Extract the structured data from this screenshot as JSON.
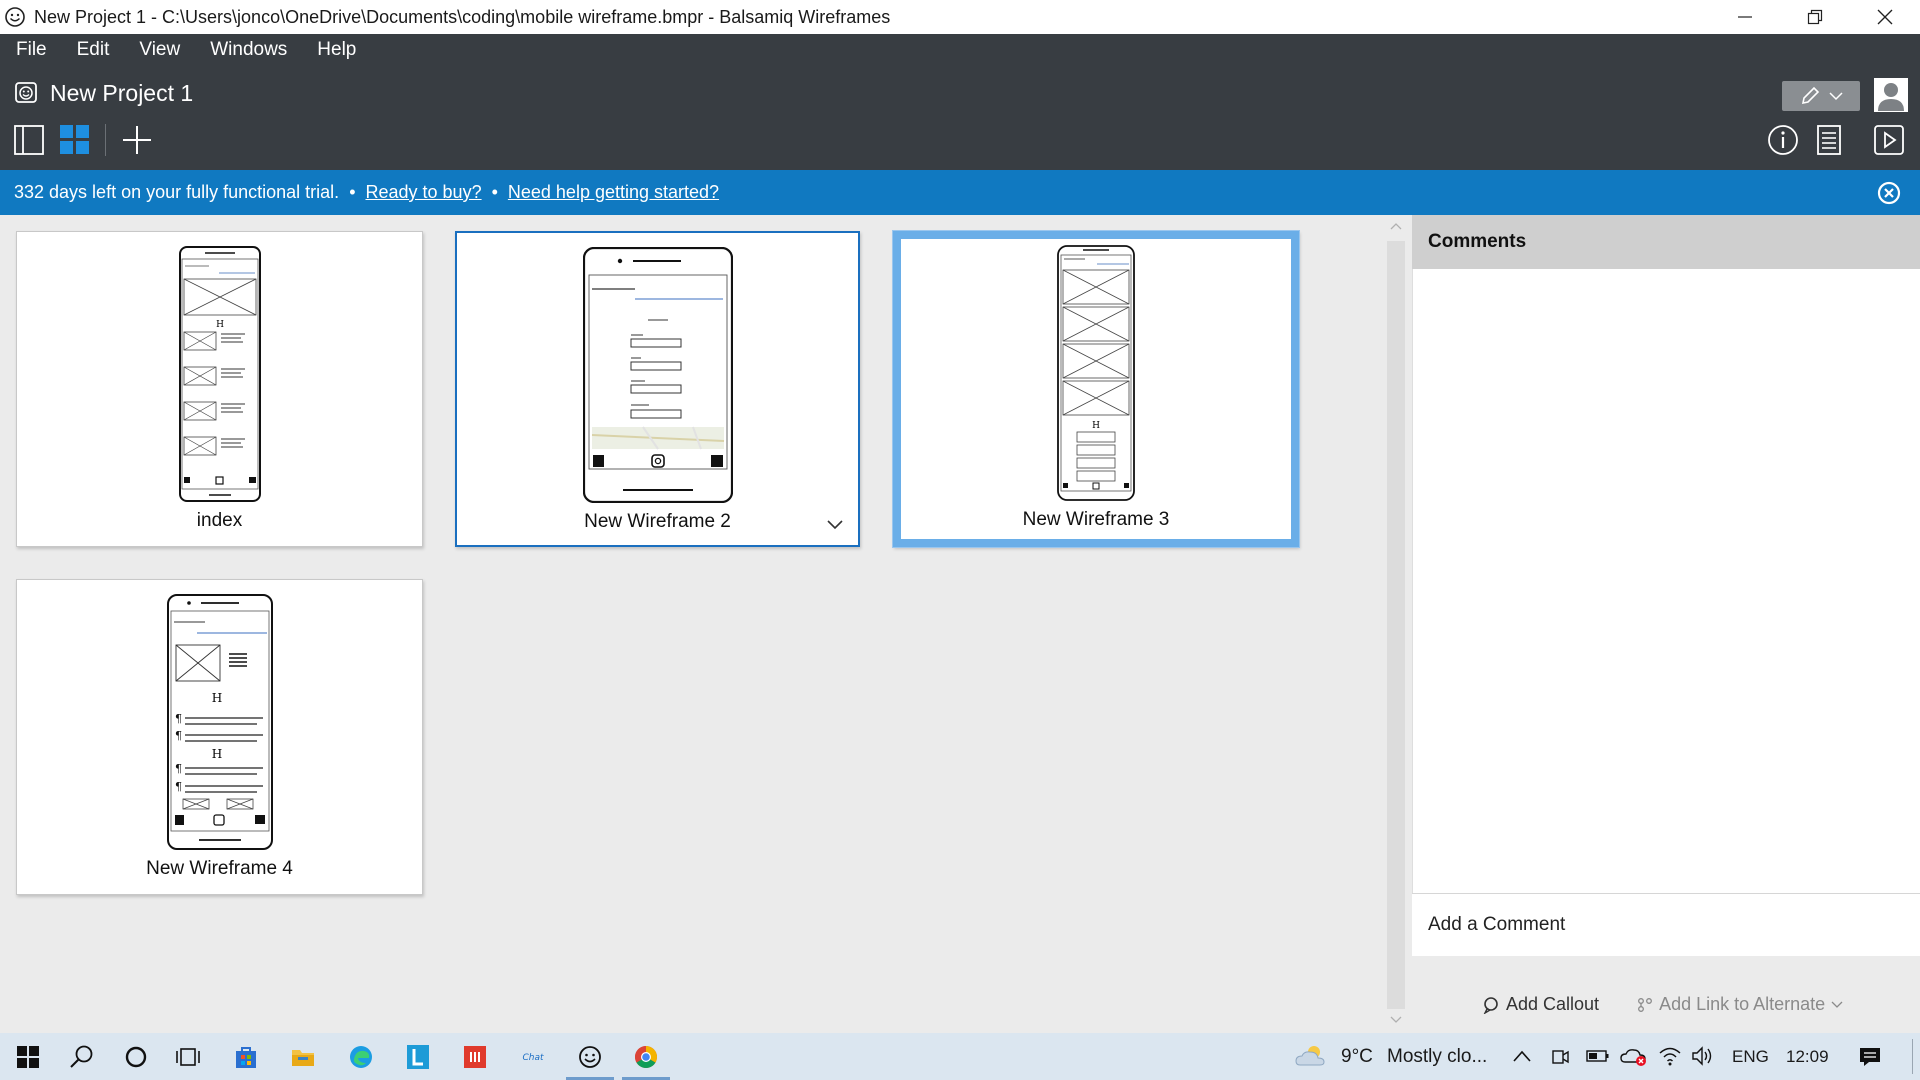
{
  "window": {
    "title": "New Project 1 - C:\\Users\\jonco\\OneDrive\\Documents\\coding\\mobile wireframe.bmpr - Balsamiq Wireframes"
  },
  "menu": [
    "File",
    "Edit",
    "View",
    "Windows",
    "Help"
  ],
  "project": {
    "title": "New Project 1"
  },
  "trial": {
    "message": "332 days left on your fully functional trial.",
    "buy_link": "Ready to buy?",
    "help_link": "Need help getting started?"
  },
  "wireframes": [
    {
      "label": "index"
    },
    {
      "label": "New Wireframe 2"
    },
    {
      "label": "New Wireframe 3"
    },
    {
      "label": "New Wireframe 4"
    }
  ],
  "comments": {
    "header": "Comments",
    "add_comment": "Add a Comment",
    "add_callout": "Add Callout",
    "add_link": "Add Link to Alternate"
  },
  "taskbar": {
    "weather_temp": "9°C",
    "weather_text": "Mostly clo...",
    "language": "ENG",
    "time": "12:09"
  },
  "colors": {
    "chrome": "#383d42",
    "trial_bar": "#1079c1",
    "selected_border": "#1a6fbf",
    "highlight_border": "#6aaee8"
  }
}
